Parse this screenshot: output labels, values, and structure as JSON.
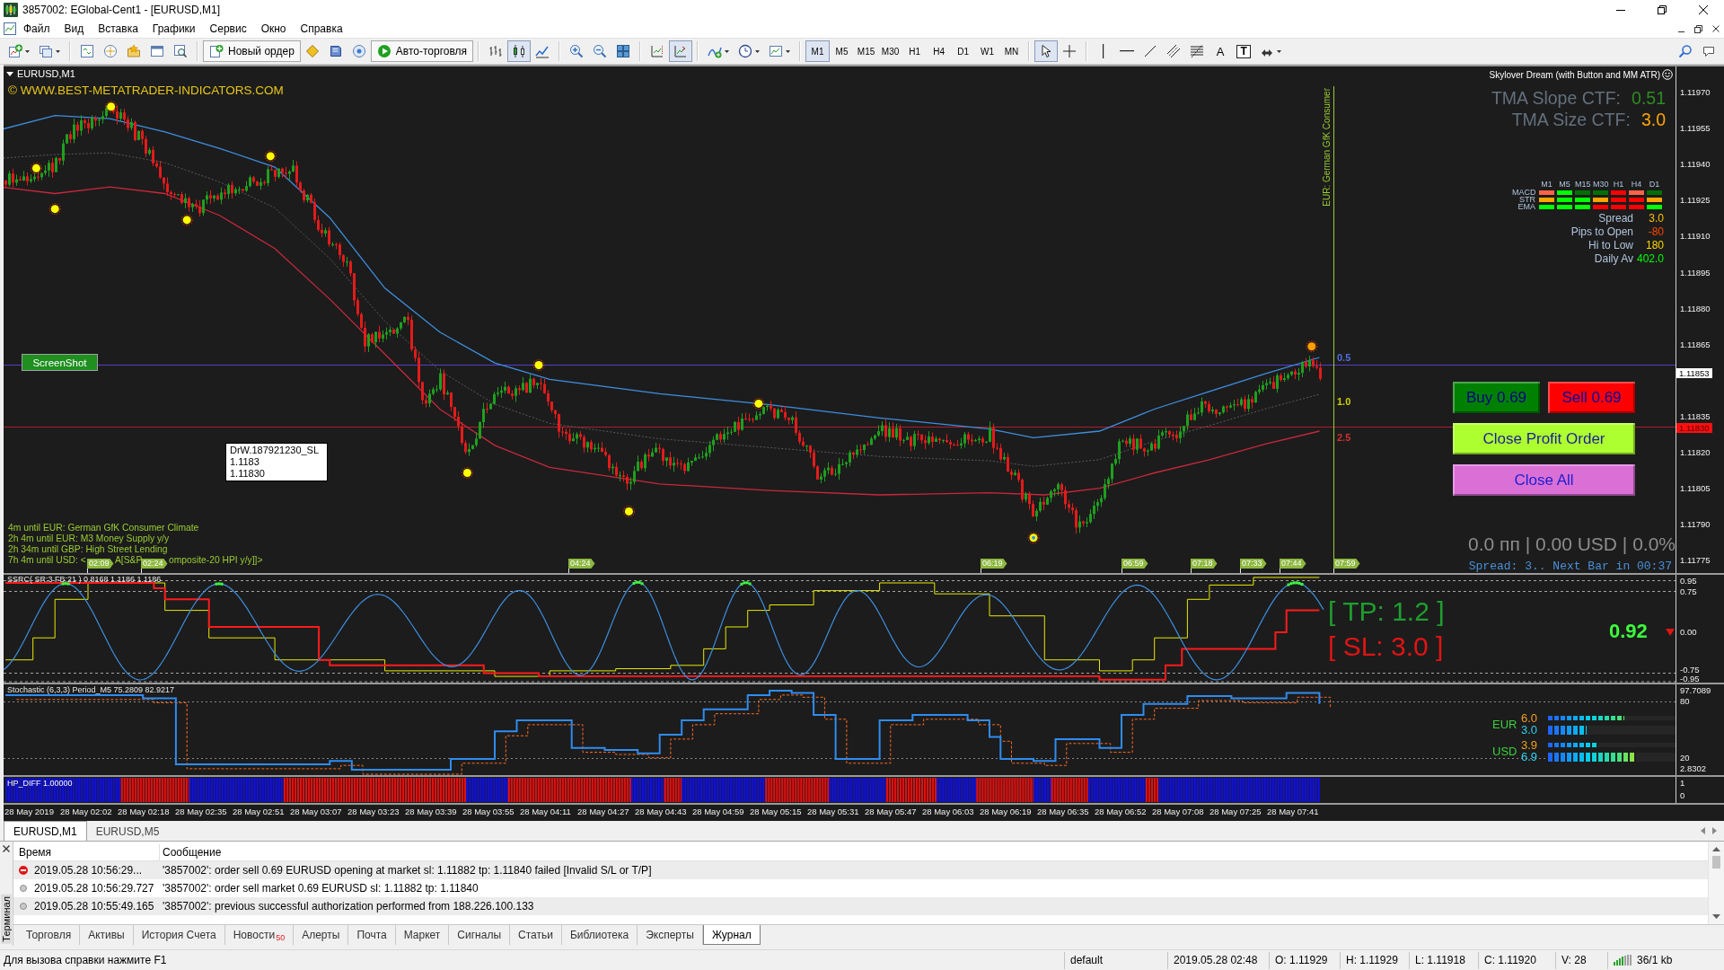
{
  "window": {
    "title": "3857002: EGlobal-Cent1 - [EURUSD,M1]"
  },
  "menu": [
    "Файл",
    "Вид",
    "Вставка",
    "Графики",
    "Сервис",
    "Окно",
    "Справка"
  ],
  "toolbar": {
    "new_order": "Новый ордер",
    "auto_trading": {
      "label": "Авто-торговля",
      "on": true
    },
    "chart_types": [
      {
        "kind": "bars",
        "selected": false
      },
      {
        "kind": "candles",
        "selected": true
      },
      {
        "kind": "line",
        "selected": false
      }
    ],
    "chart_options": [
      {
        "kind": "shift",
        "on": false
      },
      {
        "kind": "autoscroll",
        "on": true
      }
    ],
    "timeframes": [
      {
        "label": "M1",
        "selected": true
      },
      {
        "label": "M5",
        "selected": false
      },
      {
        "label": "M15",
        "selected": false
      },
      {
        "label": "M30",
        "selected": false
      },
      {
        "label": "H1",
        "selected": false
      },
      {
        "label": "H4",
        "selected": false
      },
      {
        "label": "D1",
        "selected": false
      },
      {
        "label": "W1",
        "selected": false
      },
      {
        "label": "MN",
        "selected": false
      }
    ],
    "draw_tools": [
      {
        "kind": "cursor",
        "selected": true
      },
      {
        "kind": "crosshair",
        "selected": false
      },
      {
        "kind": "vertical_line",
        "selected": false
      },
      {
        "kind": "horizontal_line",
        "selected": false
      },
      {
        "kind": "trend_line",
        "selected": false
      },
      {
        "kind": "channel",
        "selected": false
      },
      {
        "kind": "fibonacci",
        "selected": false
      },
      {
        "kind": "text",
        "label": "A",
        "selected": false
      },
      {
        "kind": "text_label",
        "label": "T",
        "selected": false
      },
      {
        "kind": "arrows",
        "selected": false
      }
    ]
  },
  "chart": {
    "symbol": "EURUSD,M1",
    "copyright": "© WWW.BEST-METATRADER-INDICATORS.COM",
    "indicator_name": "Skylover Dream (with Button and MM ATR)",
    "tma": [
      {
        "label": "TMA Slope CTF:",
        "value": "0.51",
        "color": "#2e8b22"
      },
      {
        "label": "TMA Size CTF:",
        "value": "3.0",
        "color": "#ffa500"
      }
    ],
    "signal_grid": {
      "timeframes": [
        "M1",
        "M5",
        "M15",
        "M30",
        "H1",
        "H4",
        "D1"
      ],
      "rows": [
        {
          "label": "MACD",
          "cells": [
            {
              "color": "#ff6347"
            },
            {
              "color": "#00ff00"
            },
            {
              "color": "#007000"
            },
            {
              "color": "#007000"
            },
            {
              "color": "#ff0000"
            },
            {
              "color": "#ff6347"
            },
            {
              "color": "#007000"
            }
          ]
        },
        {
          "label": "STR",
          "cells": [
            {
              "color": "#ffa500"
            },
            {
              "color": "#00ff00"
            },
            {
              "color": "#00ff00"
            },
            {
              "color": "#ffa500"
            },
            {
              "color": "#ff0000"
            },
            {
              "color": "#ff0000"
            },
            {
              "color": "#ffa500"
            }
          ]
        },
        {
          "label": "EMA",
          "cells": [
            {
              "color": "#00ff00"
            },
            {
              "color": "#00ff00"
            },
            {
              "color": "#00ff00"
            },
            {
              "color": "#ff0000"
            },
            {
              "color": "#ff0000"
            },
            {
              "color": "#ff0000"
            },
            {
              "color": "#00ff00"
            }
          ]
        }
      ]
    },
    "stats": [
      {
        "label": "Spread",
        "value": "3.0",
        "color": "#ffc000"
      },
      {
        "label": "Pips to Open",
        "value": "-80",
        "color": "#ff4500"
      },
      {
        "label": "Hi to Low",
        "value": "180",
        "color": "#ffd700"
      },
      {
        "label": "Daily Av",
        "value": "402.0",
        "color": "#00ff00"
      }
    ],
    "screenshot_button": "ScreenShot",
    "order_tooltip": [
      "DrW.187921230_SL",
      "1.1183",
      "1.11830"
    ],
    "event_line_label": "EUR: German GfK Consumer",
    "level_labels": [
      {
        "label": "0.5",
        "color": "#4f6fe0"
      },
      {
        "label": "1.0",
        "color": "#d0d000"
      },
      {
        "label": "2.5",
        "color": "#d03030"
      }
    ],
    "trade_buttons": [
      {
        "kind": "buy",
        "label": "Buy 0.69"
      },
      {
        "kind": "sell",
        "label": "Sell 0.69"
      },
      {
        "kind": "close_profit",
        "label": "Close Profit Order"
      },
      {
        "kind": "close_all",
        "label": "Close All"
      }
    ],
    "news": [
      "4m until EUR: German GfK Consumer Climate",
      "2h 4m until EUR: M3 Money Supply y/y",
      "2h 34m until GBP: High Street Lending"
    ],
    "news_cut_line": [
      "7h 4m until USD: <",
      "A[S&P",
      "omposite-20 HPI y/y]]>"
    ],
    "time_markers": [
      "02:09",
      "02:24",
      "04:24",
      "06:19",
      "06:59",
      "07:18",
      "07:33",
      "07:44",
      "07:59"
    ],
    "profit_summary": "0.0 пп | 0.00 USD | 0.0%",
    "spread_timer": "Spread: 3.. Next Bar in 00:37",
    "price_axis": [
      "1.11970",
      "1.11955",
      "1.11940",
      "1.11925",
      "1.11910",
      "1.11895",
      "1.11880",
      "1.11865",
      "1.11835",
      "1.11820",
      "1.11805",
      "1.11790",
      "1.11775"
    ],
    "price_markers": [
      {
        "kind": "bid",
        "label": "1.11853"
      },
      {
        "kind": "order",
        "label": "1.11830"
      }
    ]
  },
  "oscillator": {
    "title": "SSRC( SR:3  FB:21 ) 0.8168 1.1186 1.1186",
    "take_profit": "[ TP: 1.2 ]",
    "stop_loss": "[ SL: 3.0 ]",
    "value": "0.92",
    "axis": [
      "0.95",
      "0.75",
      "0.00",
      "-0.75",
      "-0.95"
    ]
  },
  "stochastic": {
    "title": "Stochastic (6,3,3) Period_M5 75.2809 82.9217",
    "currencies": [
      {
        "name": "EUR",
        "meters": [
          {
            "value": "6.0",
            "color": "#f0a020",
            "level": 0.6
          },
          {
            "value": "3.0",
            "color": "#30d0f0",
            "level": 0.3
          }
        ]
      },
      {
        "name": "USD",
        "meters": [
          {
            "value": "3.9",
            "color": "#f0a020",
            "level": 0.39
          },
          {
            "value": "6.9",
            "color": "#30d0f0",
            "level": 0.69
          }
        ]
      }
    ],
    "axis": [
      "97.7089",
      "80",
      "20",
      "2.8302"
    ]
  },
  "histogram": {
    "title": "HP_DIFF 1.00000",
    "axis": [
      "1",
      "0"
    ]
  },
  "time_axis": [
    "28 May 2019",
    "28 May 02:02",
    "28 May 02:18",
    "28 May 02:35",
    "28 May 02:51",
    "28 May 03:07",
    "28 May 03:23",
    "28 May 03:39",
    "28 May 03:55",
    "28 May 04:11",
    "28 May 04:27",
    "28 May 04:43",
    "28 May 04:59",
    "28 May 05:15",
    "28 May 05:31",
    "28 May 05:47",
    "28 May 06:03",
    "28 May 06:19",
    "28 May 06:35",
    "28 May 06:52",
    "28 May 07:08",
    "28 May 07:25",
    "28 May 07:41"
  ],
  "chart_tabs": [
    {
      "label": "EURUSD,M1",
      "selected": true
    },
    {
      "label": "EURUSD,M5",
      "selected": false
    }
  ],
  "terminal": {
    "side_title": "Терминал",
    "columns": [
      "Время",
      "Сообщение"
    ],
    "rows": [
      {
        "kind": "error",
        "time": "2019.05.28 10:56:29...",
        "message": "'3857002': order sell 0.69 EURUSD opening at market sl: 1.11882 tp: 1.11840 failed [Invalid S/L or T/P]"
      },
      {
        "kind": "info",
        "time": "2019.05.28 10:56:29.727",
        "message": "'3857002': order sell market 0.69 EURUSD sl: 1.11882 tp: 1.11840"
      },
      {
        "kind": "info",
        "time": "2019.05.28 10:55:49.165",
        "message": "'3857002': previous successful authorization performed from 188.226.100.133"
      }
    ],
    "tabs": [
      {
        "label": "Торговля",
        "selected": false
      },
      {
        "label": "Активы",
        "selected": false
      },
      {
        "label": "История Счета",
        "selected": false
      },
      {
        "label": "Новости",
        "badge": "50",
        "selected": false
      },
      {
        "label": "Алерты",
        "selected": false
      },
      {
        "label": "Почта",
        "selected": false
      },
      {
        "label": "Маркет",
        "selected": false
      },
      {
        "label": "Сигналы",
        "selected": false
      },
      {
        "label": "Статьи",
        "selected": false
      },
      {
        "label": "Библиотека",
        "selected": false
      },
      {
        "label": "Эксперты",
        "selected": false
      },
      {
        "label": "Журнал",
        "selected": true
      }
    ]
  },
  "status_bar": {
    "help": "Для вызова справки нажмите F1",
    "profile": "default",
    "datetime": "2019.05.28 02:48",
    "ohlcv": [
      "O: 1.11929",
      "H: 1.11929",
      "L: 1.11918",
      "C: 1.11920",
      "V: 28"
    ],
    "traffic": "36/1 kb"
  }
}
